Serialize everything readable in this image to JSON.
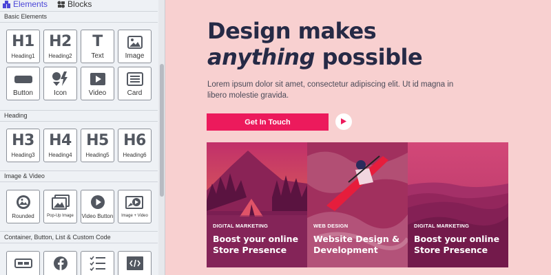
{
  "panel": {
    "tabs": [
      {
        "label": "Elements",
        "icon": "puzzle-icon",
        "active": true
      },
      {
        "label": "Blocks",
        "icon": "blocks-icon",
        "active": false
      }
    ],
    "sections": [
      {
        "title": "Basic Elements",
        "items": [
          {
            "label": "Heading1",
            "glyph": "H1",
            "icon": "heading1-icon"
          },
          {
            "label": "Heading2",
            "glyph": "H2",
            "icon": "heading2-icon"
          },
          {
            "label": "Text",
            "glyph": "T",
            "icon": "text-icon"
          },
          {
            "label": "Image",
            "glyph": "",
            "icon": "image-icon"
          },
          {
            "label": "Button",
            "glyph": "",
            "icon": "button-icon"
          },
          {
            "label": "Icon",
            "glyph": "",
            "icon": "icon-shapes-icon"
          },
          {
            "label": "Video",
            "glyph": "",
            "icon": "video-icon"
          },
          {
            "label": "Card",
            "glyph": "",
            "icon": "card-icon"
          }
        ]
      },
      {
        "title": "Heading",
        "items": [
          {
            "label": "Heading3",
            "glyph": "H3",
            "icon": "heading3-icon"
          },
          {
            "label": "Heading4",
            "glyph": "H4",
            "icon": "heading4-icon"
          },
          {
            "label": "Heading5",
            "glyph": "H5",
            "icon": "heading5-icon"
          },
          {
            "label": "Heading6",
            "glyph": "H6",
            "icon": "heading6-icon"
          }
        ]
      },
      {
        "title": "Image & Video",
        "items": [
          {
            "label": "Rounded",
            "icon": "rounded-image-icon"
          },
          {
            "label": "Pop-Up Image",
            "icon": "popup-image-icon"
          },
          {
            "label": "Video Button",
            "icon": "video-button-icon"
          },
          {
            "label": "Image + Video",
            "icon": "image-video-icon"
          }
        ]
      },
      {
        "title": "Container, Button, List & Custom Code",
        "items": [
          {
            "label": "",
            "icon": "container-button-icon"
          },
          {
            "label": "",
            "icon": "facebook-icon"
          },
          {
            "label": "",
            "icon": "list-icon"
          },
          {
            "label": "",
            "icon": "code-icon"
          }
        ]
      }
    ]
  },
  "hero": {
    "title_line1": "Design makes",
    "title_em": "anything",
    "title_line2_rest": " possible",
    "body": "Lorem ipsum dolor sit amet, consectetur adipiscing elit. Ut id magna in libero molestie gravida.",
    "cta_label": "Get In Touch",
    "play_icon": "play-icon"
  },
  "cards": [
    {
      "category": "DIGITAL MARKETING",
      "title": "Boost your online Store Presence",
      "image": "mountain-tent"
    },
    {
      "category": "WEB DESIGN",
      "title": "Website Design & Development",
      "image": "kayak"
    },
    {
      "category": "DIGITAL MARKETING",
      "title": "Boost your online Store Presence",
      "image": "hills"
    }
  ],
  "colors": {
    "accent": "#ec1a5c",
    "page_bg": "#f8d0d0",
    "title_text": "#262a46",
    "tab_active": "#4b46d8",
    "card_overlay": "#b0195c"
  }
}
